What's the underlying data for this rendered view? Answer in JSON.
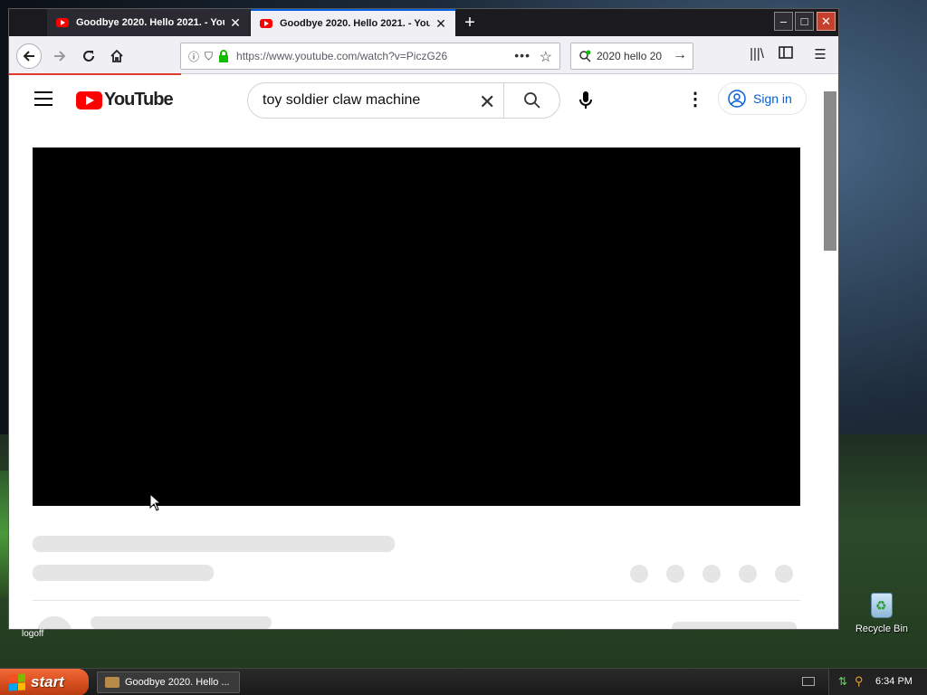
{
  "browser": {
    "tabs": [
      {
        "title": "Goodbye 2020. Hello 2021. - YouTube",
        "active": false
      },
      {
        "title": "Goodbye 2020. Hello 2021. - YouTube",
        "active": true
      }
    ],
    "url": "https://www.youtube.com/watch?v=PiczG26",
    "search_box": "2020 hello 20"
  },
  "youtube": {
    "logo_text": "YouTube",
    "search_value": "toy soldier claw machine",
    "signin_label": "Sign in"
  },
  "desktop": {
    "logoff_label": "logoff",
    "recycle_bin_label": "Recycle Bin"
  },
  "taskbar": {
    "start_label": "start",
    "task_item": "Goodbye 2020. Hello ...",
    "clock": "6:34 PM"
  },
  "colors": {
    "youtube_red": "#ff0000",
    "link_blue": "#065fd4",
    "start_orange": "#d8501f"
  },
  "icons": [
    "back-icon",
    "forward-icon",
    "reload-icon",
    "home-icon",
    "lock-icon",
    "star-icon",
    "library-icon",
    "sidebar-icon",
    "menu-icon",
    "search-icon",
    "mic-icon",
    "user-icon",
    "close-icon"
  ]
}
